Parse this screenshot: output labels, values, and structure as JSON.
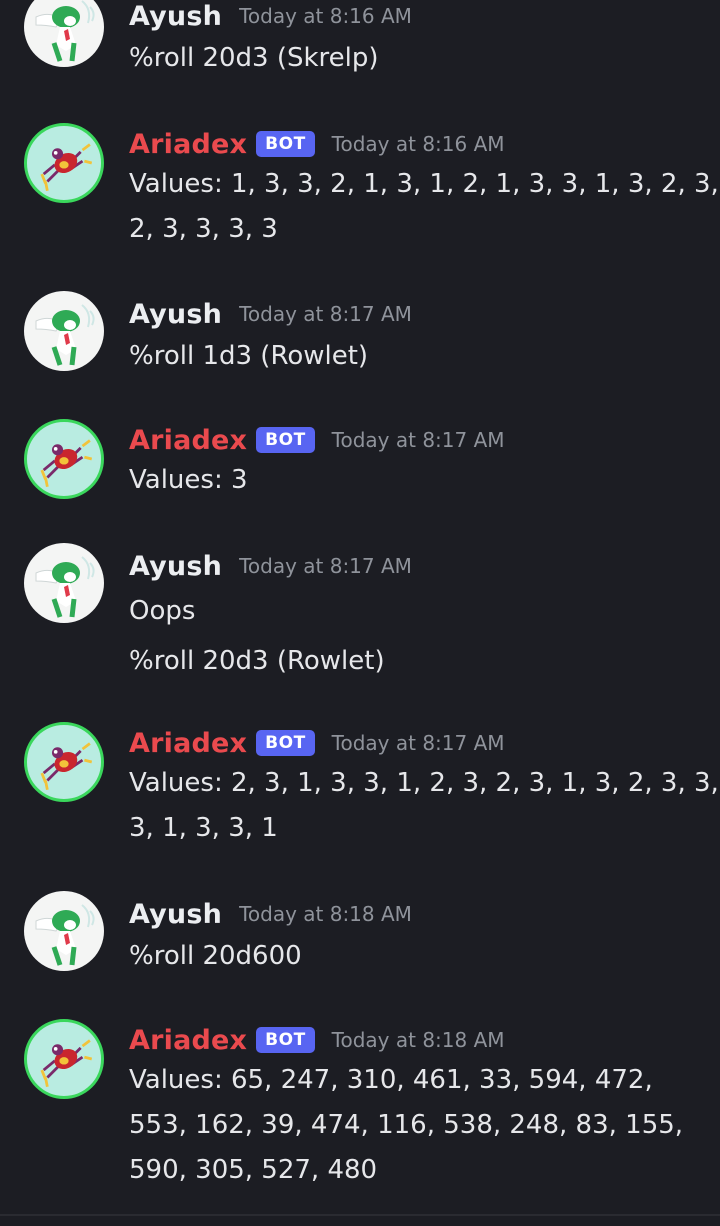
{
  "users": {
    "ayush": {
      "name": "Ayush"
    },
    "ariadex": {
      "name": "Ariadex",
      "badge": "BOT"
    }
  },
  "messages": [
    {
      "author": "Ayush",
      "time": "Today at 8:16 AM",
      "lines": [
        "%roll 20d3 (Skrelp)"
      ]
    },
    {
      "author": "Ariadex",
      "badge": "BOT",
      "time": "Today at 8:16 AM",
      "lines": [
        "Values: 1, 3, 3, 2, 1, 3, 1, 2, 1, 3, 3, 1, 3, 2, 3,",
        "2, 3, 3, 3, 3"
      ]
    },
    {
      "author": "Ayush",
      "time": "Today at 8:17 AM",
      "lines": [
        "%roll 1d3 (Rowlet)"
      ]
    },
    {
      "author": "Ariadex",
      "badge": "BOT",
      "time": "Today at 8:17 AM",
      "lines": [
        "Values: 3"
      ]
    },
    {
      "author": "Ayush",
      "time": "Today at 8:17 AM",
      "lines": [
        "Oops",
        "%roll 20d3 (Rowlet)"
      ]
    },
    {
      "author": "Ariadex",
      "badge": "BOT",
      "time": "Today at 8:17 AM",
      "lines": [
        "Values: 2, 3, 1, 3, 3, 1, 2, 3, 2, 3, 1, 3, 2, 3, 3,",
        "3, 1, 3, 3, 1"
      ]
    },
    {
      "author": "Ayush",
      "time": "Today at 8:18 AM",
      "lines": [
        "%roll 20d600"
      ]
    },
    {
      "author": "Ariadex",
      "badge": "BOT",
      "time": "Today at 8:18 AM",
      "lines": [
        "Values: 65, 247, 310, 461, 33, 594, 472,",
        "553, 162, 39, 474, 116, 538, 248, 83, 155,",
        "590, 305, 527, 480"
      ]
    }
  ],
  "colors": {
    "background": "#1c1d23",
    "bot_name": "#ea4a4e",
    "badge": "#5865f2",
    "timestamp": "#8f939b",
    "bot_avatar_ring": "#3ad75c"
  },
  "icons": {
    "user_avatar": "gallade-avatar-icon",
    "bot_avatar": "ariados-avatar-icon"
  }
}
